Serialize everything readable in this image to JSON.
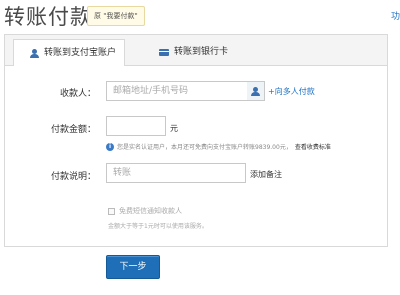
{
  "header": {
    "title": "转账付款",
    "tip_badge": "原 \"我要付款\"",
    "right_link": "功"
  },
  "tabs": [
    {
      "label": "转账到支付宝账户",
      "icon": "user-icon",
      "active": true
    },
    {
      "label": "转账到银行卡",
      "icon": "bank-card-icon",
      "active": false
    }
  ],
  "form": {
    "recipient_label": "收款人：",
    "recipient_placeholder": "邮箱地址/手机号码",
    "multi_recipient_link": "+向多人付款",
    "amount_label": "付款金额：",
    "amount_value": "",
    "amount_unit": "元",
    "amount_info": "您是实名认证用户，本月还可免费向支付宝账户转账9839.00元，",
    "amount_info_link": "查看收费标准",
    "memo_label": "付款说明：",
    "memo_placeholder": "转账",
    "add_note": "添加备注",
    "sms_label": "免费短信通知收款人",
    "sms_note": "金额大于等于1元时可以使用该服务。"
  },
  "actions": {
    "next_label": "下一步"
  },
  "colors": {
    "primary": "#1e6fb7",
    "link": "#1a6fc4",
    "border": "#d9d9d9"
  }
}
